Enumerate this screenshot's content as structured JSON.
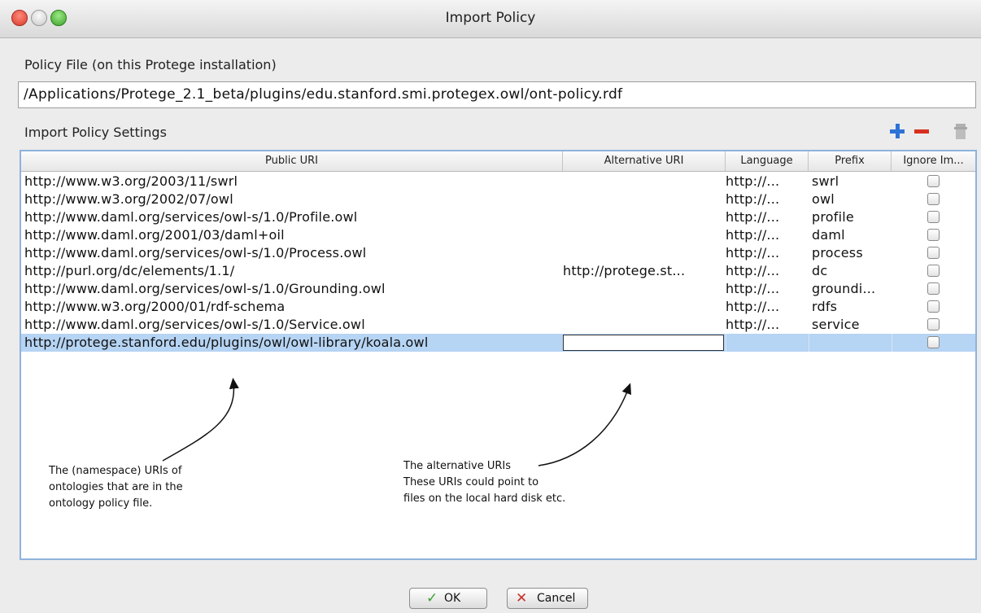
{
  "window": {
    "title": "Import Policy"
  },
  "policy_file": {
    "label": "Policy File (on this Protege installation)",
    "path": "/Applications/Protege_2.1_beta/plugins/edu.stanford.smi.protegex.owl/ont-policy.rdf"
  },
  "settings": {
    "label": "Import Policy Settings",
    "icons": [
      "plus-icon",
      "minus-icon",
      "delete-icon"
    ]
  },
  "table": {
    "columns": [
      "Public URI",
      "Alternative URI",
      "Language",
      "Prefix",
      "Ignore Im..."
    ],
    "rows": [
      {
        "public_uri": "http://www.w3.org/2003/11/swrl",
        "alternative_uri": "",
        "language": "http://...",
        "prefix": "swrl",
        "ignore": false
      },
      {
        "public_uri": "http://www.w3.org/2002/07/owl",
        "alternative_uri": "",
        "language": "http://...",
        "prefix": "owl",
        "ignore": false
      },
      {
        "public_uri": "http://www.daml.org/services/owl-s/1.0/Profile.owl",
        "alternative_uri": "",
        "language": "http://...",
        "prefix": "profile",
        "ignore": false
      },
      {
        "public_uri": "http://www.daml.org/2001/03/daml+oil",
        "alternative_uri": "",
        "language": "http://...",
        "prefix": "daml",
        "ignore": false
      },
      {
        "public_uri": "http://www.daml.org/services/owl-s/1.0/Process.owl",
        "alternative_uri": "",
        "language": "http://...",
        "prefix": "process",
        "ignore": false
      },
      {
        "public_uri": "http://purl.org/dc/elements/1.1/",
        "alternative_uri": "http://protege.st...",
        "language": "http://...",
        "prefix": "dc",
        "ignore": false
      },
      {
        "public_uri": "http://www.daml.org/services/owl-s/1.0/Grounding.owl",
        "alternative_uri": "",
        "language": "http://...",
        "prefix": "groundi...",
        "ignore": false
      },
      {
        "public_uri": "http://www.w3.org/2000/01/rdf-schema",
        "alternative_uri": "",
        "language": "http://...",
        "prefix": "rdfs",
        "ignore": false
      },
      {
        "public_uri": "http://www.daml.org/services/owl-s/1.0/Service.owl",
        "alternative_uri": "",
        "language": "http://...",
        "prefix": "service",
        "ignore": false
      },
      {
        "public_uri": "http://protege.stanford.edu/plugins/owl/owl-library/koala.owl",
        "alternative_uri": "",
        "language": "",
        "prefix": "",
        "ignore": false,
        "selected": true,
        "editing_alternative": true
      }
    ]
  },
  "annotations": {
    "public_uri_note": [
      "The (namespace) URIs of",
      "ontologies that are in the",
      "ontology policy file."
    ],
    "alternative_uri_note": [
      "The alternative URIs",
      "These URIs could point to",
      "files on the local hard disk etc."
    ]
  },
  "buttons": {
    "ok": "OK",
    "cancel": "Cancel"
  },
  "colors": {
    "selection": "#b6d4f3",
    "add": "#2c73d6",
    "remove": "#d8301e",
    "ok_check": "#3aa034",
    "cancel_x": "#c8322a"
  }
}
